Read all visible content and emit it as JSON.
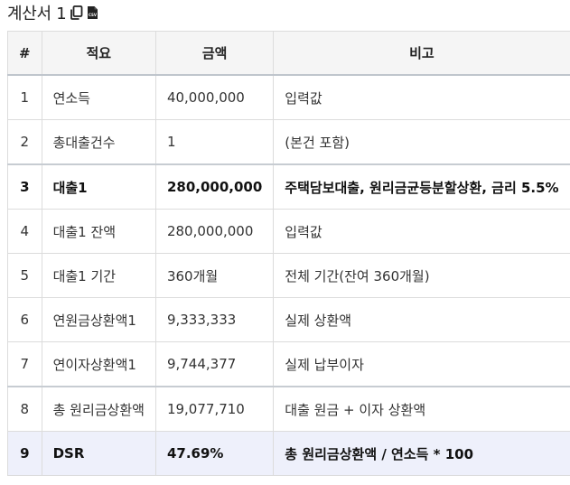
{
  "header": {
    "title": "계산서 1",
    "copy_icon": "copy-icon",
    "csv_icon": "csv-file-icon"
  },
  "table": {
    "columns": [
      "#",
      "적요",
      "금액",
      "비고"
    ],
    "rows": [
      {
        "num": "1",
        "desc": "연소득",
        "amount": "40,000,000",
        "note": "입력값",
        "bold": false
      },
      {
        "num": "2",
        "desc": "총대출건수",
        "amount": "1",
        "note": "(본건 포함)",
        "bold": false
      },
      {
        "num": "3",
        "desc": "대출1",
        "amount": "280,000,000",
        "note": "주택담보대출, 원리금균등분할상환, 금리 5.5%",
        "bold": true
      },
      {
        "num": "4",
        "desc": "대출1 잔액",
        "amount": "280,000,000",
        "note": "입력값",
        "bold": false
      },
      {
        "num": "5",
        "desc": "대출1 기간",
        "amount": "360개월",
        "note": "전체 기간(잔여 360개월)",
        "bold": false
      },
      {
        "num": "6",
        "desc": "연원금상환액1",
        "amount": "9,333,333",
        "note": "실제 상환액",
        "bold": false
      },
      {
        "num": "7",
        "desc": "연이자상환액1",
        "amount": "9,744,377",
        "note": "실제 납부이자",
        "bold": false
      },
      {
        "num": "8",
        "desc": "총 원리금상환액",
        "amount": "19,077,710",
        "note": "대출 원금 + 이자 상환액",
        "bold": false
      },
      {
        "num": "9",
        "desc": "DSR",
        "amount": "47.69%",
        "note": "총 원리금상환액 / 연소득 * 100",
        "bold": true
      }
    ]
  },
  "colors": {
    "header_bg": "#f5f5f5",
    "highlight_row_bg": "#eef0fb",
    "border": "#dcdcdc"
  }
}
